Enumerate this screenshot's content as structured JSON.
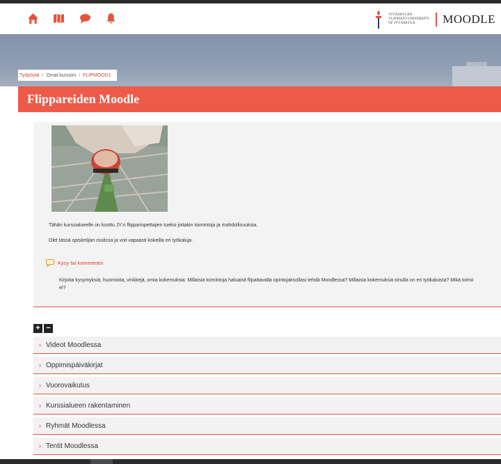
{
  "navbar": {
    "icons": [
      "home-icon",
      "map-icon",
      "chat-icon",
      "bell-icon"
    ],
    "brand_university": "Jyväskylän yliopisto University of Jyväskylä",
    "brand_name": "MOODLE"
  },
  "breadcrumb": {
    "items": [
      "Työpöytä",
      "Omat kurssini",
      "FLIPMOOD1"
    ],
    "separator": "/"
  },
  "course": {
    "title": "Flippareiden Moodle"
  },
  "summary": {
    "line1": "Tähän kurssialueelle on koottu JY:n flippariopettajien tueksi joitakin toimintoja ja mahdollisuuksia.",
    "line2_prefix": "Olet tässä ",
    "line2_emph": "opiskelijan roolissa",
    "line2_suffix": " ja voit vapaasti kokeilla eri työkaluja."
  },
  "forum": {
    "link_label": "Kysy tai kommentoi",
    "description_line1": "Kirjoita kysymyksiä, huomioita, vinkkejä, omia kokemuksia: Millaisia toimintoja haluaisit flipattavalla opintojaksollasi tehdä Moodlessa? Millaisia kokemuksia sinulla on eri työkaluista? Mikä toimii",
    "description_line2": "ei?"
  },
  "toggles": {
    "expand_label": "+",
    "collapse_label": "−"
  },
  "sections": [
    {
      "label": "Videot Moodlessa"
    },
    {
      "label": "Oppimispäiväkirjat"
    },
    {
      "label": "Vuorovaikutus"
    },
    {
      "label": "Kurssialueen rakentaminen"
    },
    {
      "label": "Ryhmät Moodlessa"
    },
    {
      "label": "Tentit Moodlessa"
    }
  ],
  "colors": {
    "accent": "#e5533d",
    "title_bar": "#ee5a48",
    "link": "#d4412e"
  }
}
